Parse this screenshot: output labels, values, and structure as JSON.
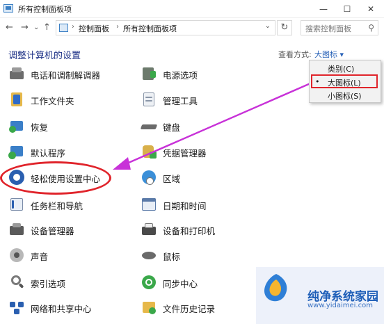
{
  "window": {
    "title": "所有控制面板项",
    "minimize": "—",
    "maximize": "☐",
    "close": "✕"
  },
  "nav": {
    "back": "←",
    "forward": "→",
    "recent": "⌄",
    "up": "↑",
    "breadcrumb": [
      "控制面板",
      "所有控制面板项"
    ],
    "sep": "›",
    "refresh": "↻",
    "search_placeholder": "搜索控制面板",
    "search_icon": "⚲"
  },
  "header": {
    "title": "调整计算机的设置",
    "viewby_label": "查看方式:",
    "viewby_value": "大图标 ▾"
  },
  "items_left": [
    {
      "label": "电话和调制解调器",
      "icon": "phone-modem-icon"
    },
    {
      "label": "工作文件夹",
      "icon": "work-folders-icon"
    },
    {
      "label": "恢复",
      "icon": "recovery-icon"
    },
    {
      "label": "默认程序",
      "icon": "default-programs-icon"
    },
    {
      "label": "轻松使用设置中心",
      "icon": "ease-of-access-icon"
    },
    {
      "label": "任务栏和导航",
      "icon": "taskbar-icon"
    },
    {
      "label": "设备管理器",
      "icon": "device-manager-icon"
    },
    {
      "label": "声音",
      "icon": "sound-icon"
    },
    {
      "label": "索引选项",
      "icon": "indexing-icon"
    },
    {
      "label": "网络和共享中心",
      "icon": "network-icon"
    }
  ],
  "items_right": [
    {
      "label": "电源选项",
      "icon": "power-icon"
    },
    {
      "label": "管理工具",
      "icon": "admin-tools-icon"
    },
    {
      "label": "键盘",
      "icon": "keyboard-icon"
    },
    {
      "label": "凭据管理器",
      "icon": "credential-icon"
    },
    {
      "label": "区域",
      "icon": "region-icon"
    },
    {
      "label": "日期和时间",
      "icon": "datetime-icon"
    },
    {
      "label": "设备和打印机",
      "icon": "printer-icon"
    },
    {
      "label": "鼠标",
      "icon": "mouse-icon"
    },
    {
      "label": "同步中心",
      "icon": "sync-icon"
    },
    {
      "label": "文件历史记录",
      "icon": "file-history-icon"
    }
  ],
  "dropdown": {
    "options": [
      "类别(C)",
      "大图标(L)",
      "小图标(S)"
    ],
    "selected_bullet": "•"
  },
  "watermark": {
    "name": "纯净系统家园",
    "url": "www.yidaimei.com"
  },
  "colors": {
    "accent": "#1e3287",
    "highlight": "#e0242b",
    "arrow": "#c832d8",
    "link": "#2a63b8"
  }
}
